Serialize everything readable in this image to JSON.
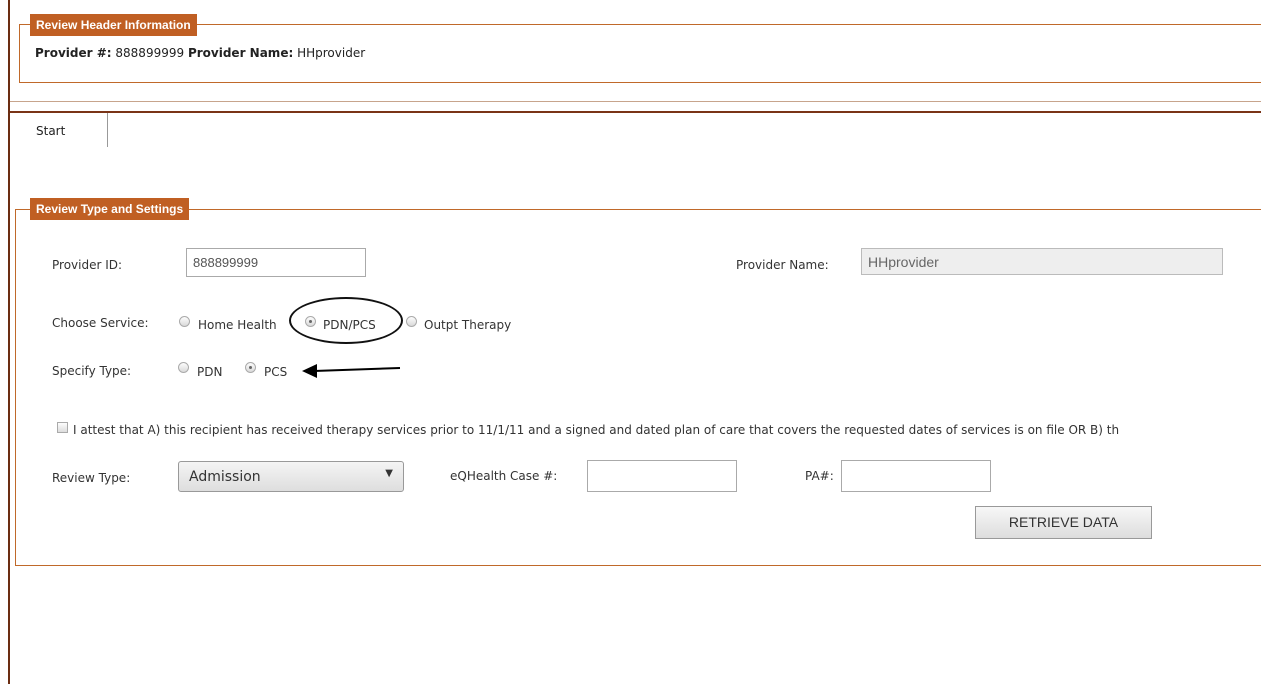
{
  "review_header": {
    "legend": "Review Header Information",
    "provider_num_label": "Provider #:",
    "provider_num_value": "888899999",
    "provider_name_label": "Provider Name:",
    "provider_name_value": "HHprovider"
  },
  "tabs": [
    {
      "label": "Start"
    }
  ],
  "review_settings": {
    "legend": "Review Type and Settings",
    "provider_id_label": "Provider ID:",
    "provider_id_value": "888899999",
    "provider_name_label": "Provider Name:",
    "provider_name_value": "HHprovider",
    "choose_service_label": "Choose Service:",
    "services": [
      {
        "label": "Home Health",
        "checked": false
      },
      {
        "label": "PDN/PCS",
        "checked": true
      },
      {
        "label": "Outpt Therapy",
        "checked": false
      }
    ],
    "specify_type_label": "Specify Type:",
    "types": [
      {
        "label": "PDN",
        "checked": false
      },
      {
        "label": "PCS",
        "checked": true
      }
    ],
    "attest_text": "I attest that A) this recipient has received therapy services prior to 11/1/11 and a signed and dated plan of care that covers the requested dates of services is on file OR B) th",
    "review_type_label": "Review Type:",
    "review_type_value": "Admission",
    "case_label": "eQHealth Case #:",
    "case_value": "",
    "pa_label": "PA#:",
    "pa_value": "",
    "retrieve_label": "RETRIEVE DATA"
  },
  "colors": {
    "legend_bg": "#c05f23",
    "border": "#c0692a",
    "frame": "#6b2d12"
  }
}
